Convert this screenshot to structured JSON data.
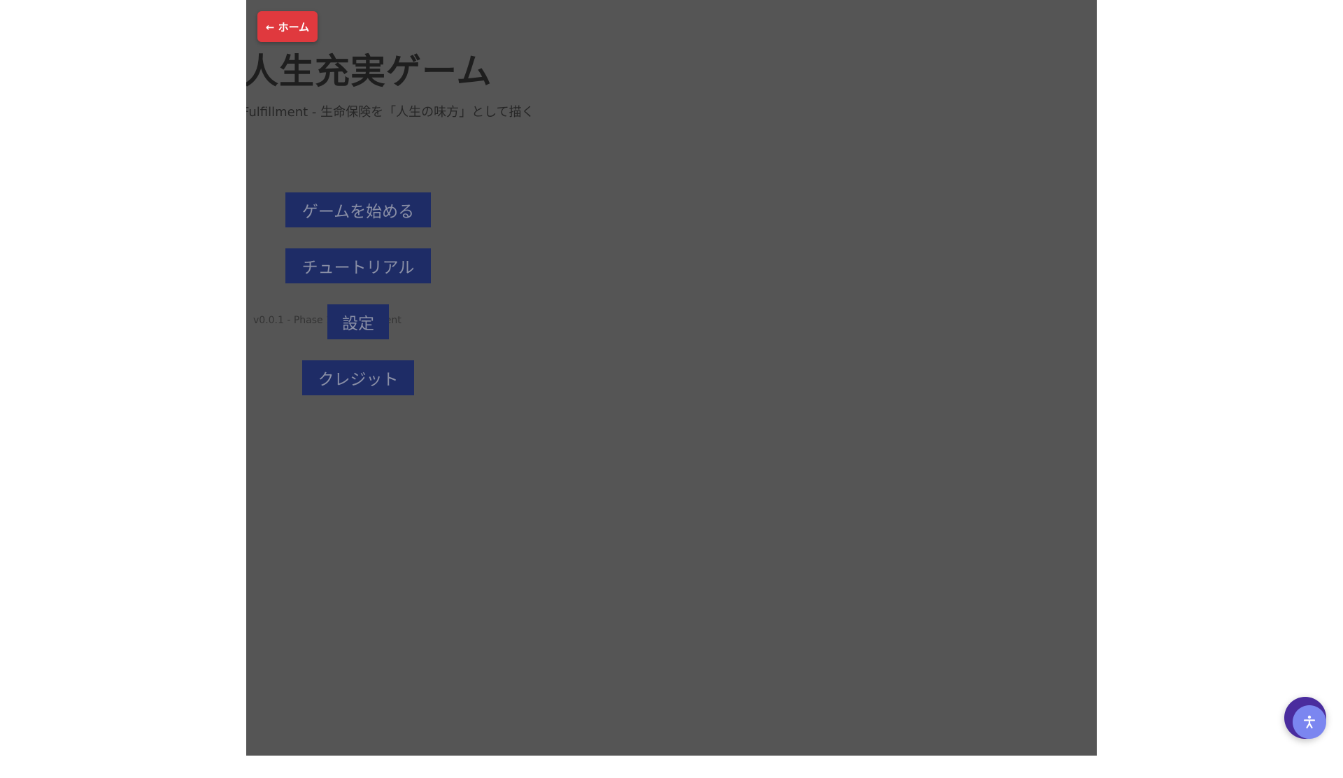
{
  "nav": {
    "home_label": "← ホーム"
  },
  "game": {
    "title": "人生充実ゲーム",
    "subtitle": "Fulfillment - 生命保険を「人生の味方」として描く",
    "version": "v0.0.1 - Phase 1 Development",
    "menu": {
      "start": "ゲームを始める",
      "tutorial": "チュートリアル",
      "settings": "設定",
      "credits": "クレジット"
    }
  },
  "fab": {
    "icon": "accessibility-icon"
  },
  "colors": {
    "frame_overlay": "#555555",
    "home_button": "#e0393e",
    "menu_button": "#1e2c66",
    "fab_outer": "#4a2c9e",
    "fab_inner": "#7b86f0"
  }
}
